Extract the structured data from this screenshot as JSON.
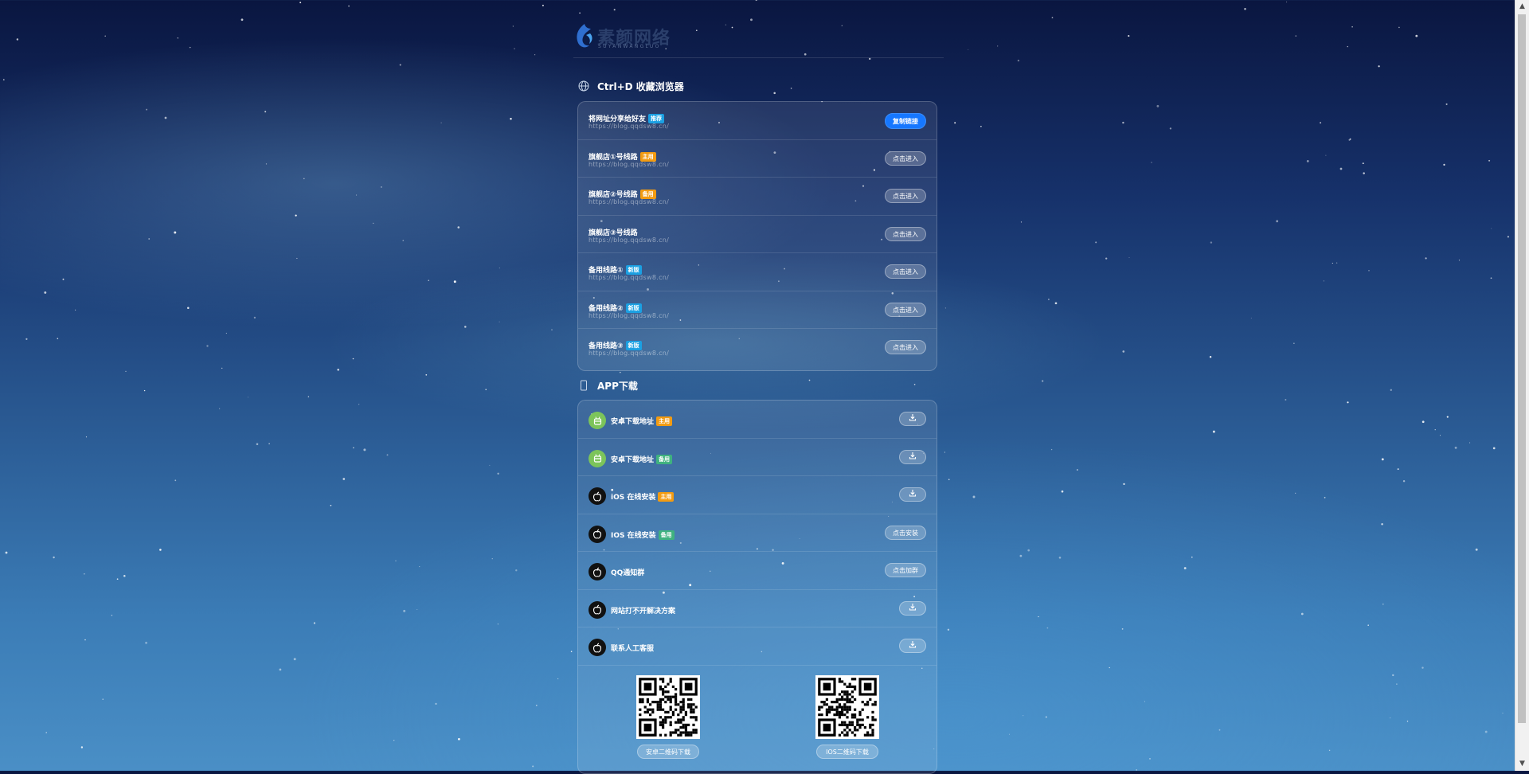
{
  "brand": {
    "name": "素颜网络",
    "subtitle": "SUYANWANGLUO"
  },
  "colors": {
    "primary": "#1677ff",
    "tag_orange": "#f29b12",
    "tag_blue": "#1ba0e2",
    "tag_green": "#3fb27f",
    "android_green": "#7cc45a"
  },
  "bookmark_section": {
    "title": "Ctrl+D 收藏浏览器",
    "icon": "globe-icon"
  },
  "links": [
    {
      "title": "将网址分享给好友",
      "tag": "推荐",
      "tag_color": "blue",
      "url": "https://blog.qqdsw8.cn/",
      "button": "复制链接",
      "primary": true
    },
    {
      "title": "旗舰店①号线路",
      "tag": "主用",
      "tag_color": "orange",
      "url": "https://blog.qqdsw8.cn/",
      "button": "点击进入"
    },
    {
      "title": "旗舰店②号线路",
      "tag": "备用",
      "tag_color": "orange",
      "url": "https://blog.qqdsw8.cn/",
      "button": "点击进入"
    },
    {
      "title": "旗舰店③号线路",
      "tag": "",
      "tag_color": "",
      "url": "https://blog.qqdsw8.cn/",
      "button": "点击进入"
    },
    {
      "title": "备用线路①",
      "tag": "新版",
      "tag_color": "blue",
      "url": "https://blog.qqdsw8.cn/",
      "button": "点击进入"
    },
    {
      "title": "备用线路②",
      "tag": "新版",
      "tag_color": "blue",
      "url": "https://blog.qqdsw8.cn/",
      "button": "点击进入"
    },
    {
      "title": "备用线路③",
      "tag": "新版",
      "tag_color": "blue",
      "url": "https://blog.qqdsw8.cn/",
      "button": "点击进入"
    }
  ],
  "app_section": {
    "title": "APP下载",
    "icon": "phone-icon"
  },
  "apps": [
    {
      "name": "安卓下载地址",
      "tag": "主用",
      "tag_color": "orange",
      "icon": "android-icon",
      "button": "",
      "button_icon": "download-icon"
    },
    {
      "name": "安卓下载地址",
      "tag": "备用",
      "tag_color": "green",
      "icon": "android-icon",
      "button": "",
      "button_icon": "download-icon"
    },
    {
      "name": "iOS 在线安装",
      "tag": "主用",
      "tag_color": "orange",
      "icon": "apple-icon",
      "button": "",
      "button_icon": "download-icon"
    },
    {
      "name": "IOS 在线安装",
      "tag": "备用",
      "tag_color": "green",
      "icon": "apple-icon",
      "button": "点击安装",
      "button_icon": ""
    },
    {
      "name": "QQ通知群",
      "tag": "",
      "tag_color": "",
      "icon": "apple-icon",
      "button": "点击加群",
      "button_icon": ""
    },
    {
      "name": "网站打不开解决方案",
      "tag": "",
      "tag_color": "",
      "icon": "apple-icon",
      "button": "",
      "button_icon": "download-icon"
    },
    {
      "name": "联系人工客服",
      "tag": "",
      "tag_color": "",
      "icon": "apple-icon",
      "button": "",
      "button_icon": "download-icon"
    }
  ],
  "qrcodes": [
    {
      "label": "安卓二维码下载"
    },
    {
      "label": "IOS二维码下载"
    }
  ]
}
